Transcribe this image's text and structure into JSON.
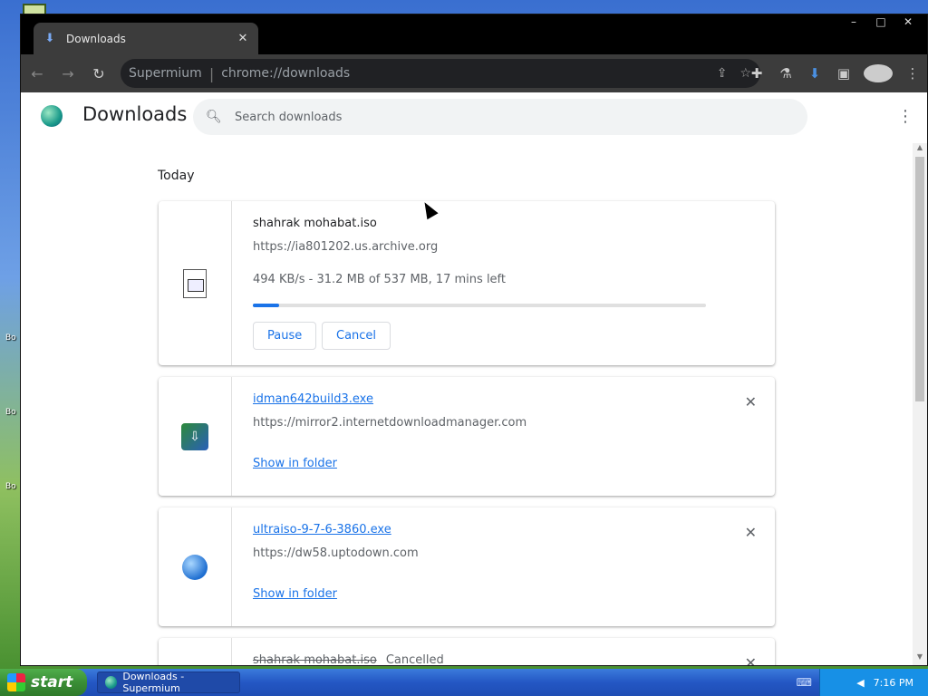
{
  "desktop": {
    "left_labels": [
      "Bo",
      "Bo",
      "Bo"
    ]
  },
  "browser": {
    "tab_title": "Downloads",
    "url_host": "Supermium",
    "url_path": "chrome://downloads",
    "window_controls": [
      "–",
      "□",
      "✕"
    ]
  },
  "downloads_page": {
    "title": "Downloads",
    "search_placeholder": "Search downloads",
    "section_label": "Today",
    "items": [
      {
        "file_name": "shahrak mohabat.iso",
        "source_url": "https://ia801202.us.archive.org",
        "status": "494 KB/s - 31.2 MB of 537 MB, 17 mins left",
        "progress_percent": 5.8,
        "actions": [
          "Pause",
          "Cancel"
        ]
      },
      {
        "file_name": "idman642build3.exe",
        "source_url": "https://mirror2.internetdownloadmanager.com",
        "action": "Show in folder"
      },
      {
        "file_name": "ultraiso-9-7-6-3860.exe",
        "source_url": "https://dw58.uptodown.com",
        "action": "Show in folder"
      },
      {
        "file_name": "shahrak mohabat.iso",
        "status_tag": "Cancelled"
      }
    ]
  },
  "taskbar": {
    "start_label": "start",
    "task_title": "Downloads - Supermium",
    "clock": "7:16 PM"
  },
  "colors": {
    "accent": "#1a73e8",
    "toolbar": "#3c3c3c",
    "titlebar": "#000000"
  }
}
